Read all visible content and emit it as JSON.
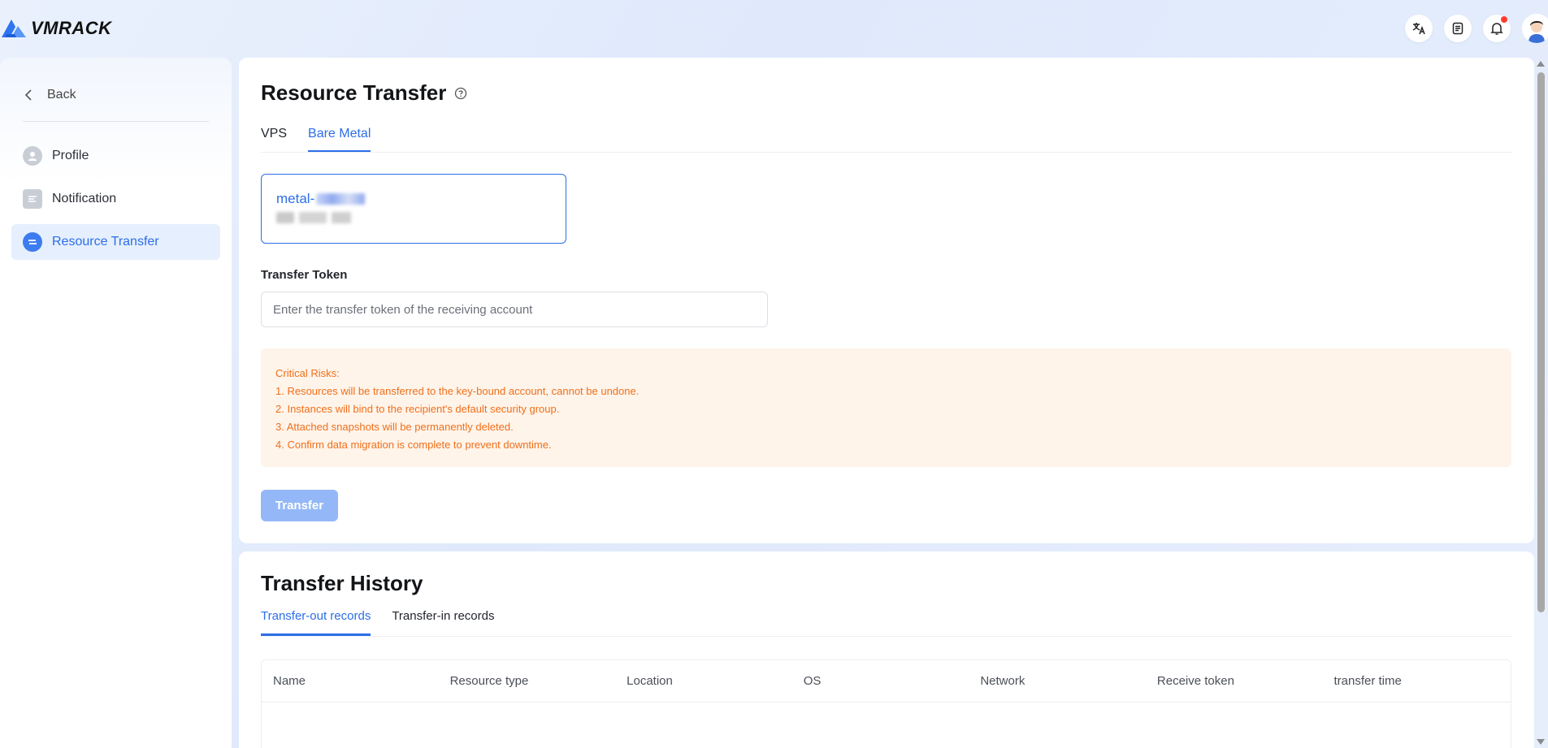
{
  "header": {
    "brand": "VMRACK",
    "icons": [
      "translate-icon",
      "document-icon",
      "bell-icon"
    ],
    "has_notification_dot": true
  },
  "sidebar": {
    "back_label": "Back",
    "items": [
      {
        "label": "Profile",
        "icon": "profile-icon",
        "active": false
      },
      {
        "label": "Notification",
        "icon": "notification-icon",
        "active": false
      },
      {
        "label": "Resource Transfer",
        "icon": "transfer-icon",
        "active": true
      }
    ]
  },
  "main": {
    "title": "Resource Transfer",
    "tabs": [
      {
        "label": "VPS",
        "active": false
      },
      {
        "label": "Bare Metal",
        "active": true
      }
    ],
    "resource": {
      "name_prefix": "metal-"
    },
    "token_label": "Transfer Token",
    "token_placeholder": "Enter the transfer token of the receiving account",
    "warning": {
      "heading": "Critical Risks:",
      "lines": [
        "1. Resources will be transferred to the key-bound account, cannot be undone.",
        "2. Instances will bind to the recipient's default security group.",
        "3. Attached snapshots will be permanently deleted.",
        "4. Confirm data migration is complete to prevent downtime."
      ]
    },
    "transfer_button": "Transfer"
  },
  "history": {
    "title": "Transfer History",
    "tabs": [
      {
        "label": "Transfer-out records",
        "active": true
      },
      {
        "label": "Transfer-in records",
        "active": false
      }
    ],
    "columns": [
      "Name",
      "Resource type",
      "Location",
      "OS",
      "Network",
      "Receive token",
      "transfer time"
    ]
  },
  "colors": {
    "accent": "#2b6ee8",
    "warning_text": "#f06f1a",
    "warning_bg": "#fff4ea",
    "button_disabled": "#94b8f7"
  }
}
